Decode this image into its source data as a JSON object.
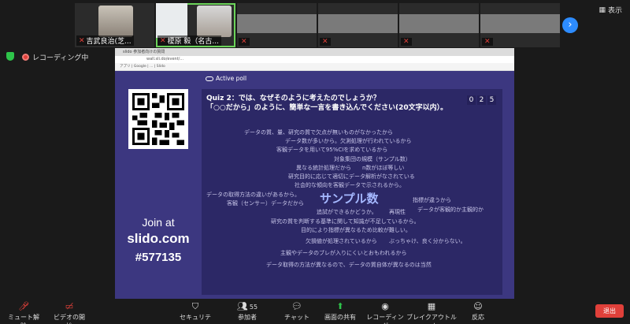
{
  "participants": [
    {
      "name": "吉武良治(芝...",
      "muted": true
    },
    {
      "name": "榎原 毅（名古...",
      "muted": true
    },
    {
      "name": "",
      "muted": true
    },
    {
      "name": "",
      "muted": true
    },
    {
      "name": "",
      "muted": true
    },
    {
      "name": "",
      "muted": true
    }
  ],
  "view_label": "表示",
  "recording_label": "レコーディング中",
  "browser": {
    "tab": "slido 参加者向けの質問",
    "url": "wall.sli.do/event/...",
    "bookmarks": "アプリ  | Google  | ...  | Slido"
  },
  "slido": {
    "active_poll": "Active poll",
    "join_at": "Join at",
    "join_domain": "slido.com",
    "event_code": "#577135",
    "question_line1": "Quiz 2：では、なぜそのように考えたのでしょうか？",
    "question_line2": "「○○だから」のように、簡単な一言を書き込んでください(20文字以内）。",
    "counter": [
      "0",
      "2",
      "5"
    ],
    "words": [
      {
        "text": "データの質、量、研究の質で欠点が無いものがなかったから"
      },
      {
        "text": "データ数が多いから。欠測処理が行われているから"
      },
      {
        "text": "客観データを用いて95%CIを求めているから"
      },
      {
        "text": "対象集団の規模（サンプル数）"
      },
      {
        "text": "異なる統計処理だから"
      },
      {
        "text": "n数がほぼ等しい"
      },
      {
        "text": "研究目的に応じて適切にデータ解析がなされている"
      },
      {
        "text": "社会的な傾向を客観データで示されるから。"
      },
      {
        "text": "データの取得方法の違いがあるから。"
      },
      {
        "text": "客観（センサー）データだから"
      },
      {
        "text": "サンプル数"
      },
      {
        "text": "指標が違うから"
      },
      {
        "text": "追試ができるかどうか。"
      },
      {
        "text": "再現性"
      },
      {
        "text": "データが客観的か主観的か"
      },
      {
        "text": "研究の質を判断する基準に関して知識が不足しているから。"
      },
      {
        "text": "目的により指標が異なるため比較が難しい。"
      },
      {
        "text": "欠損値が処理されているから"
      },
      {
        "text": "ぶっちゃけ、良く分からない。"
      },
      {
        "text": "主観やデータのブレが入りにくいとおもわれるから"
      },
      {
        "text": "データ取得の方法が異なるので、データの質自体が異なるのは当然"
      }
    ]
  },
  "toolbar": {
    "mute": "ミュート解除",
    "video": "ビデオの開始",
    "security": "セキュリティ",
    "participants": "参加者",
    "participants_count": "55",
    "chat": "チャット",
    "share": "画面の共有",
    "record": "レコーディング",
    "breakout": "ブレイクアウトルーム",
    "reactions": "反応",
    "leave": "退出"
  }
}
